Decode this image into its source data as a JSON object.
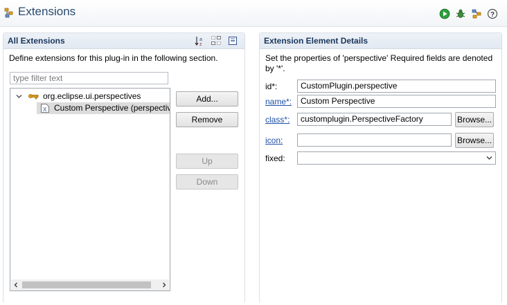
{
  "header": {
    "title": "Extensions",
    "title_icon": "extensions-puzzle-icon",
    "toolbar_icons": [
      "run-icon",
      "debug-icon",
      "extension-wizard-icon",
      "help-icon"
    ]
  },
  "left": {
    "title": "All Extensions",
    "toolbar_icons": [
      "sort-icon",
      "show-full-name-icon",
      "collapse-all-icon"
    ],
    "description": "Define extensions for this plug-in in the following section.",
    "filter_placeholder": "type filter text",
    "tree": [
      {
        "label": "org.eclipse.ui.perspectives",
        "expanded": true,
        "children": [
          {
            "label": "Custom Perspective (perspective)",
            "selected": true
          }
        ]
      }
    ],
    "buttons": {
      "add": "Add...",
      "remove": "Remove",
      "up": "Up",
      "down": "Down"
    }
  },
  "right": {
    "title": "Extension Element Details",
    "description_line1": "Set the properties of 'perspective' Required fields are denoted",
    "description_line2": "by '*'.",
    "fields": {
      "id": {
        "label": "id*:",
        "value": "CustomPlugin.perspective"
      },
      "name": {
        "label": "name*:",
        "value": "Custom Perspective"
      },
      "class": {
        "label": "class*:",
        "value": "customplugin.PerspectiveFactory",
        "button": "Browse..."
      },
      "icon": {
        "label": "icon:",
        "value": "",
        "button": "Browse..."
      },
      "fixed": {
        "label": "fixed:",
        "value": ""
      }
    }
  },
  "colors": {
    "title": "#2a4a6e",
    "section_title": "#19365a",
    "link": "#1f4fa6"
  }
}
